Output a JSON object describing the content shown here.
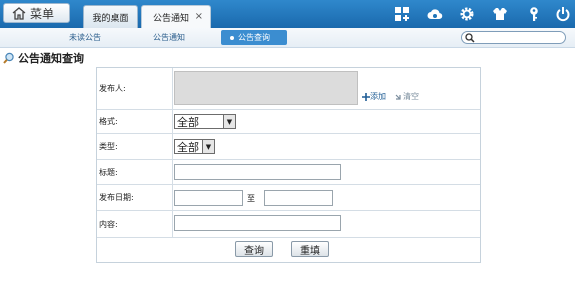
{
  "topbar": {
    "menu_label": "菜单",
    "tabs": [
      {
        "label": "我的桌面"
      },
      {
        "label": "公告通知",
        "close": "×"
      }
    ],
    "icons": [
      "grid-icon",
      "cloud-icon",
      "gear-icon",
      "shirt-icon",
      "key-icon",
      "power-icon"
    ]
  },
  "subnav": {
    "items": [
      "未读公告",
      "公告通知",
      "公告查询"
    ],
    "active_index": 2,
    "search_placeholder": ""
  },
  "page": {
    "title": "公告通知查询"
  },
  "form": {
    "sender_label": "发布人:",
    "add_label": "添加",
    "clear_label": "清空",
    "format_label": "格式:",
    "format_value": "全部",
    "type_label": "类型:",
    "type_value": "全部",
    "title_label": "标题:",
    "title_value": "",
    "date_label": "发布日期:",
    "date_to": "至",
    "date_from_value": "",
    "date_to_value": "",
    "content_label": "内容:",
    "content_value": ""
  },
  "buttons": {
    "query": "查询",
    "reset": "重填"
  },
  "colors": {
    "topbar": "#1f74b8",
    "accent": "#3b8dd0"
  }
}
